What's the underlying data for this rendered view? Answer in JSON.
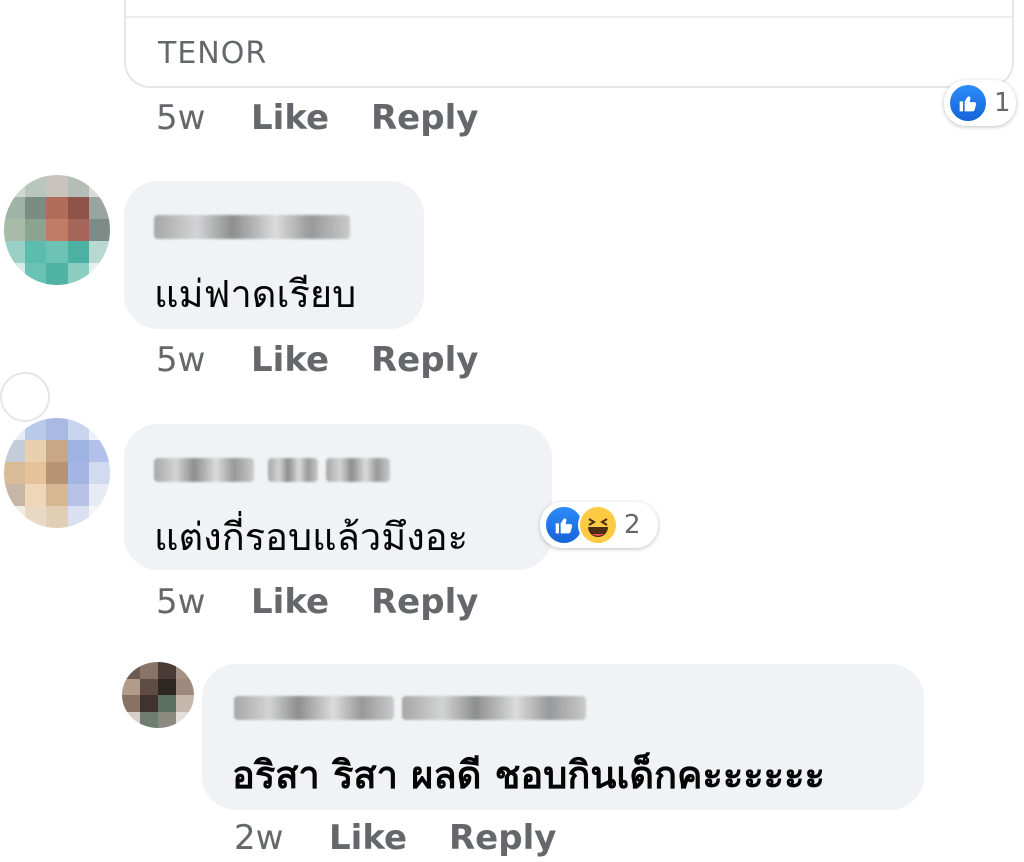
{
  "gif_card": {
    "source_label": "TENOR",
    "reaction_count": "1",
    "like_icon": "thumbs-up-icon"
  },
  "comments": [
    {
      "time": "5w",
      "like_label": "Like",
      "reply_label": "Reply"
    },
    {
      "text": "แม่ฟาดเรียบ",
      "time": "5w",
      "like_label": "Like",
      "reply_label": "Reply"
    },
    {
      "text": "แต่งกี่รอบแล้วมึงอะ",
      "reaction_count": "2",
      "reaction_icons": [
        "thumbs-up-icon",
        "laughing-face-icon"
      ],
      "time": "5w",
      "like_label": "Like",
      "reply_label": "Reply"
    },
    {
      "text": "อริสา ริสา ผลดี ชอบกินเด็กคะะะะะะ",
      "time": "2w",
      "like_label": "Like",
      "reply_label": "Reply"
    }
  ],
  "colors": {
    "bubble": "#f0f2f5",
    "meta_text": "#65676b",
    "like_blue": "#1877f2",
    "haha_yellow": "#fccb42"
  }
}
